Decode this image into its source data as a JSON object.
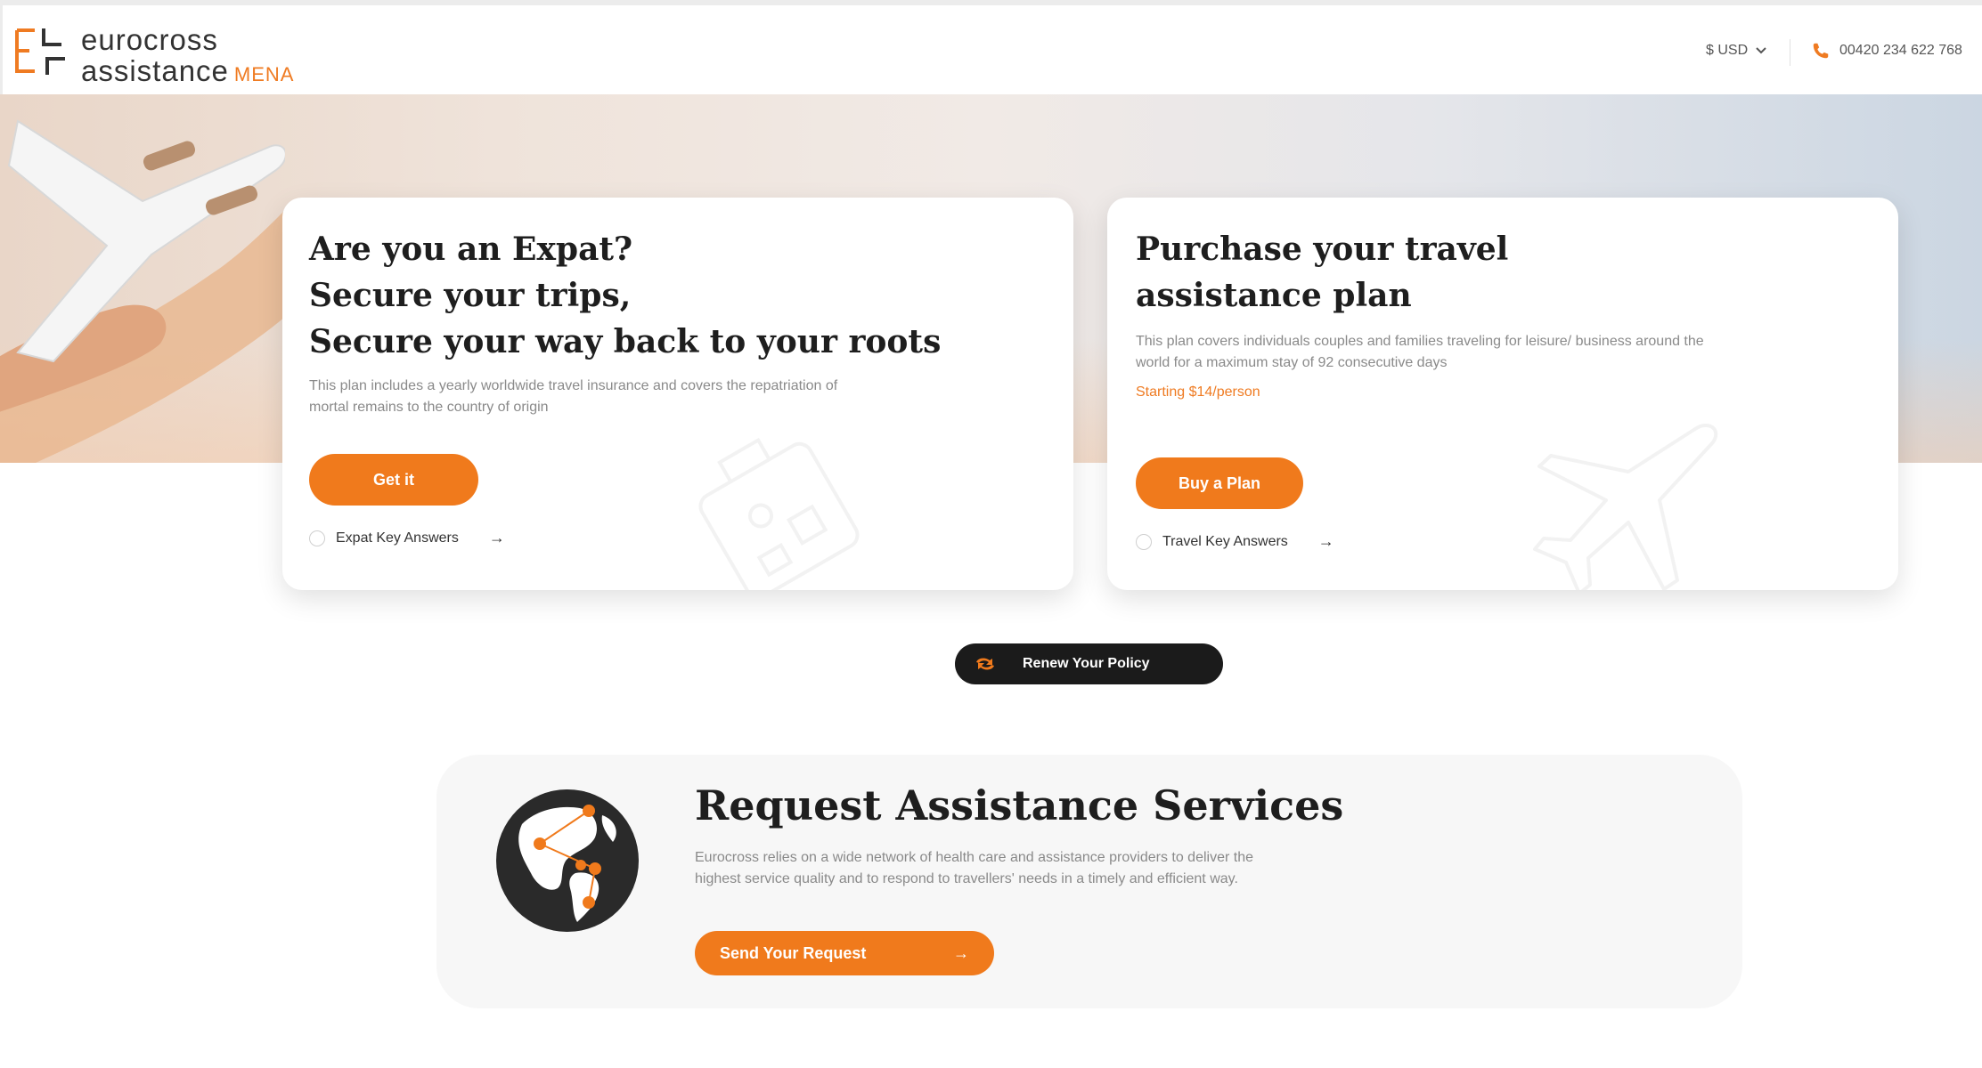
{
  "header": {
    "logo_line1": "eurocross",
    "logo_line2": "assistance",
    "logo_region": "MENA",
    "currency": "$ USD",
    "phone": "00420 234 622 768"
  },
  "expat_card": {
    "title_lines": [
      "Are you an Expat?",
      "Secure your trips,",
      "Secure your way back to your roots"
    ],
    "description": "This plan includes a yearly worldwide travel insurance and covers the repatriation of mortal remains to the country of origin",
    "button_label": "Get it",
    "link_label": "Expat Key Answers"
  },
  "travel_card": {
    "title_lines": [
      "Purchase your travel",
      "assistance plan"
    ],
    "description": "This plan covers individuals couples and families traveling for leisure/ business around the world for a maximum stay of 92 consecutive days",
    "price": "Starting $14/person",
    "button_label": "Buy a Plan",
    "link_label": "Travel Key Answers"
  },
  "renew": {
    "label": "Renew Your Policy"
  },
  "request": {
    "title": "Request Assistance Services",
    "description": "Eurocross relies on a wide network of health care and assistance providers to deliver the highest service quality and to respond to travellers' needs in a timely and efficient way.",
    "button_label": "Send Your Request"
  },
  "colors": {
    "accent": "#f07a1c",
    "dark": "#1b1b1b",
    "text": "#1e1e1e",
    "muted": "#8a8a8a"
  },
  "icons": [
    "logo-mark-icon",
    "chevron-down-icon",
    "phone-icon",
    "arrow-right-icon",
    "refresh-icon",
    "globe-icon",
    "luggage-icon",
    "airplane-icon"
  ]
}
